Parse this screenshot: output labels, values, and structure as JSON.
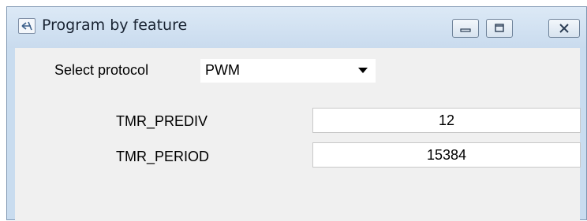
{
  "window": {
    "title": "Program by feature",
    "icon": "program-app-icon",
    "controls": [
      "minimize-icon",
      "maximize-icon",
      "close-icon"
    ]
  },
  "form": {
    "protocol_label": "Select protocol",
    "protocol_value": "PWM",
    "fields": [
      {
        "label": "TMR_PREDIV",
        "value": "12"
      },
      {
        "label": "TMR_PERIOD",
        "value": "15384"
      }
    ]
  }
}
